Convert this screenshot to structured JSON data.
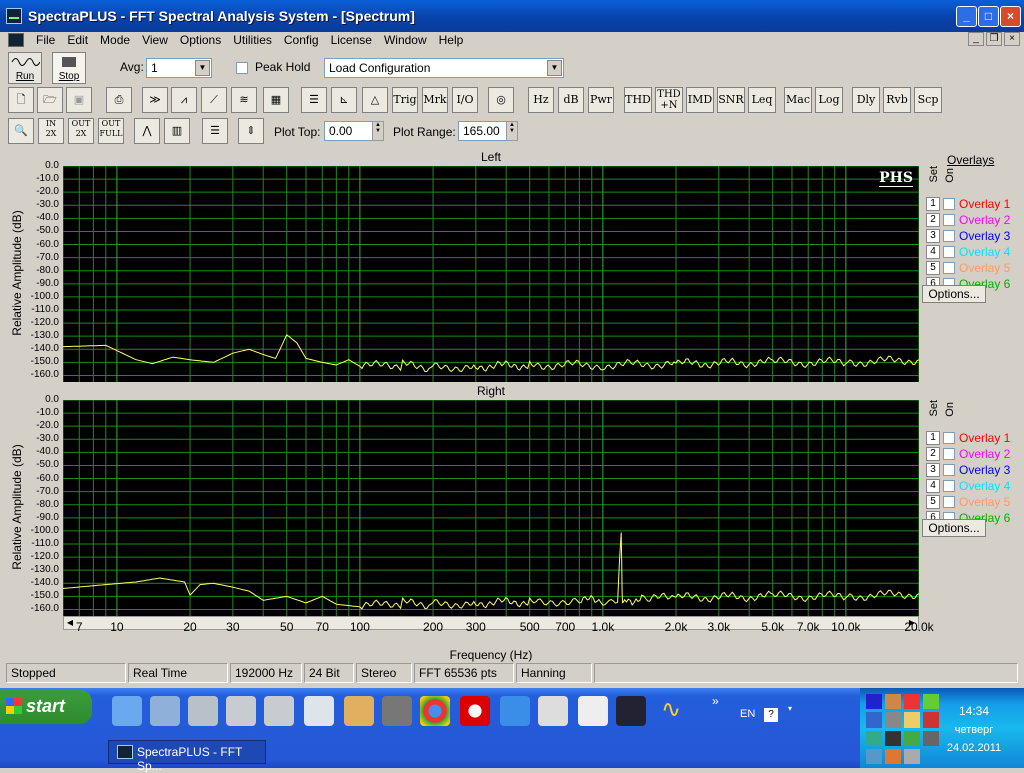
{
  "window": {
    "title": "SpectraPLUS - FFT Spectral Analysis System - [Spectrum]"
  },
  "menu": [
    "File",
    "Edit",
    "Mode",
    "View",
    "Options",
    "Utilities",
    "Config",
    "License",
    "Window",
    "Help"
  ],
  "toolbar1": {
    "run_label": "Run",
    "stop_label": "Stop",
    "avg_label": "Avg:",
    "avg_value": "1",
    "peak_hold_label": "Peak Hold",
    "config_value": "Load Configuration"
  },
  "toolbar2": [
    "Trig",
    "Mrk",
    "I/O",
    "Hz",
    "dB",
    "Pwr",
    "THD",
    "THD +N",
    "IMD",
    "SNR",
    "Leq",
    "Mac",
    "Log",
    "Dly",
    "Rvb",
    "Scp"
  ],
  "toolbar3": {
    "plot_top_label": "Plot Top:",
    "plot_top_value": "0.00",
    "plot_range_label": "Plot Range:",
    "plot_range_value": "165.00"
  },
  "overlays": {
    "header": "Overlays",
    "set_label": "Set",
    "on_label": "On",
    "items": [
      {
        "num": "1",
        "name": "Overlay 1",
        "color": "#ff0000"
      },
      {
        "num": "2",
        "name": "Overlay 2",
        "color": "#ff00ff"
      },
      {
        "num": "3",
        "name": "Overlay 3",
        "color": "#0000ff"
      },
      {
        "num": "4",
        "name": "Overlay 4",
        "color": "#00e5ff"
      },
      {
        "num": "5",
        "name": "Overlay 5",
        "color": "#ff9966"
      },
      {
        "num": "6",
        "name": "Overlay 6",
        "color": "#00b000"
      }
    ],
    "options_label": "Options..."
  },
  "chart_data": [
    {
      "type": "line",
      "title": "Left",
      "ylabel": "Relative Amplitude (dB)",
      "xlabel": "",
      "ylim": [
        -165,
        0
      ],
      "xscale": "log",
      "xlim": [
        6,
        20000
      ],
      "y_ticks": [
        "0.0",
        "-10.0",
        "-20.0",
        "-30.0",
        "-40.0",
        "-50.0",
        "-60.0",
        "-70.0",
        "-80.0",
        "-90.0",
        "-100.0",
        "-110.0",
        "-120.0",
        "-130.0",
        "-140.0",
        "-150.0",
        "-160.0"
      ],
      "series": [
        {
          "color": "#ffff66",
          "x": [
            6,
            9,
            12,
            14,
            17,
            20,
            25,
            30,
            35,
            40,
            45,
            50,
            55,
            60,
            70,
            80,
            90,
            100,
            150,
            200,
            300,
            500,
            1000,
            2000,
            5000,
            10000,
            20000
          ],
          "y": [
            -138,
            -137,
            -148,
            -151,
            -146,
            -148,
            -150,
            -143,
            -140,
            -144,
            -147,
            -129,
            -135,
            -147,
            -150,
            -152,
            -148,
            -153,
            -152,
            -154,
            -153,
            -152,
            -152,
            -151,
            -150,
            -150,
            -148
          ]
        }
      ],
      "logo": "PHS"
    },
    {
      "type": "line",
      "title": "Right",
      "ylabel": "Relative Amplitude (dB)",
      "xlabel": "Frequency (Hz)",
      "ylim": [
        -165,
        0
      ],
      "xscale": "log",
      "xlim": [
        6,
        20000
      ],
      "y_ticks": [
        "0.0",
        "-10.0",
        "-20.0",
        "-30.0",
        "-40.0",
        "-50.0",
        "-60.0",
        "-70.0",
        "-80.0",
        "-90.0",
        "-100.0",
        "-110.0",
        "-120.0",
        "-130.0",
        "-140.0",
        "-150.0",
        "-160.0"
      ],
      "x_ticks": [
        "7",
        "10",
        "20",
        "30",
        "50",
        "70",
        "100",
        "200",
        "300",
        "500",
        "700",
        "1.0k",
        "2.0k",
        "3.0k",
        "5.0k",
        "7.0k",
        "10.0k",
        "20.0k"
      ],
      "series": [
        {
          "color": "#ffff66",
          "x": [
            6,
            9,
            12,
            15,
            19,
            20,
            22,
            25,
            30,
            35,
            40,
            50,
            60,
            70,
            80,
            100,
            150,
            200,
            300,
            500,
            800,
            1000,
            1150,
            1190,
            1200,
            1210,
            1250,
            1500,
            2000,
            5000,
            10000,
            20000
          ],
          "y": [
            -144,
            -141,
            -139,
            -136,
            -139,
            -149,
            -141,
            -140,
            -143,
            -146,
            -153,
            -150,
            -155,
            -150,
            -156,
            -158,
            -155,
            -156,
            -155,
            -154,
            -153,
            -153,
            -152,
            -101,
            -150,
            -152,
            -153,
            -152,
            -151,
            -150,
            -150,
            -148
          ]
        }
      ]
    }
  ],
  "status": [
    "Stopped",
    "Real Time",
    "192000 Hz",
    "24 Bit",
    "Stereo",
    "FFT 65536 pts",
    "Hanning"
  ],
  "taskbar": {
    "start": "start",
    "task_item": "SpectraPLUS - FFT Sp...",
    "lang": "EN",
    "time": "14:34",
    "day": "четверг",
    "date": "24.02.2011"
  }
}
